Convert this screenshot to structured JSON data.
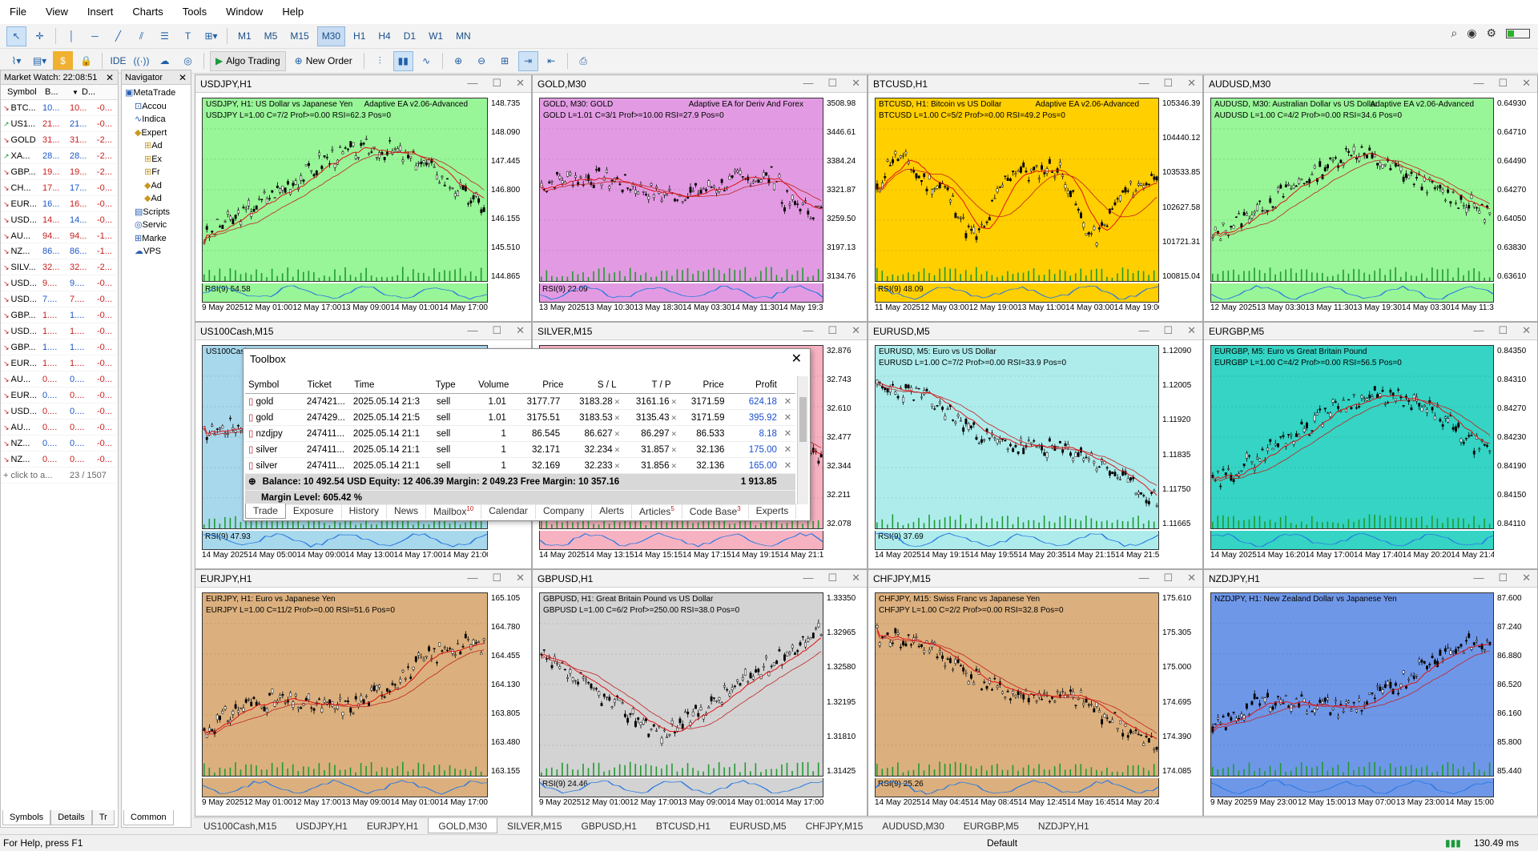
{
  "menu": [
    "File",
    "View",
    "Insert",
    "Charts",
    "Tools",
    "Window",
    "Help"
  ],
  "timeframes": [
    "M1",
    "M5",
    "M15",
    "M30",
    "H1",
    "H4",
    "D1",
    "W1",
    "MN"
  ],
  "active_tf": "M30",
  "toolbar2": {
    "ide": "IDE",
    "algo": "Algo Trading",
    "new_order": "New Order"
  },
  "market_watch": {
    "title": "Market Watch: 22:08:51",
    "cols": [
      "Symbol",
      "B...",
      "D..."
    ],
    "rows": [
      [
        "BTC...",
        "10...",
        "10..."
      ],
      [
        "US1...",
        "21...",
        "21..."
      ],
      [
        "GOLD",
        "31...",
        "31..."
      ],
      [
        "XA...",
        "28...",
        "28..."
      ],
      [
        "GBP...",
        "19...",
        "19..."
      ],
      [
        "CH...",
        "17...",
        "17..."
      ],
      [
        "EUR...",
        "16...",
        "16..."
      ],
      [
        "USD...",
        "14...",
        "14..."
      ],
      [
        "AU...",
        "94...",
        "94..."
      ],
      [
        "NZ...",
        "86...",
        "86..."
      ],
      [
        "SILV...",
        "32...",
        "32..."
      ],
      [
        "USD...",
        "9....",
        "9...."
      ],
      [
        "USD...",
        "7....",
        "7...."
      ],
      [
        "GBP...",
        "1....",
        "1...."
      ],
      [
        "USD...",
        "1....",
        "1...."
      ],
      [
        "GBP...",
        "1....",
        "1...."
      ],
      [
        "EUR...",
        "1....",
        "1...."
      ],
      [
        "AU...",
        "0....",
        "0...."
      ],
      [
        "EUR...",
        "0....",
        "0...."
      ],
      [
        "USD...",
        "0....",
        "0...."
      ],
      [
        "AU...",
        "0....",
        "0...."
      ],
      [
        "NZ...",
        "0....",
        "0...."
      ],
      [
        "NZ...",
        "0....",
        "0...."
      ]
    ],
    "third": [
      "-0...",
      "-0...",
      "-2...",
      "-2...",
      "-2...",
      "-0...",
      "-0...",
      "-0...",
      "-1...",
      "-1...",
      "-2...",
      "-0...",
      "-0...",
      "-0...",
      "-0...",
      "-0...",
      "-0...",
      "-0...",
      "-0...",
      "-0...",
      "-0...",
      "-0...",
      "-0..."
    ],
    "add": "+ click to a...",
    "count": "23 / 1507",
    "tabs": [
      "Symbols",
      "Details",
      "Tr"
    ]
  },
  "navigator": {
    "title": "Navigator",
    "items": [
      "MetaTrade",
      "Accou",
      "Indica",
      "Expert",
      "Ad",
      "Ex",
      "Fr",
      "Ad",
      "Ad",
      "Scripts",
      "Servic",
      "Marke",
      "VPS"
    ],
    "tab": "Common"
  },
  "charts": [
    {
      "title": "USDJPY,H1",
      "sym": "USDJPY, H1:  US Dollar vs Japanese Yen",
      "ea": "Adaptive EA v2.06-Advanced",
      "info": "USDJPY L=1.00 C=7/2 Prof>=0.00 RSI=62.3 Pos=0",
      "y": [
        "148.735",
        "148.090",
        "147.445",
        "146.800",
        "146.155",
        "145.510",
        "144.865"
      ],
      "x": [
        "9 May 2025",
        "12 May 01:00",
        "12 May 17:00",
        "13 May 09:00",
        "14 May 01:00",
        "14 May 17:00"
      ],
      "rsi": "RSI(9) 54.58",
      "color": "#98f598",
      "seed": 3,
      "trend": "upflat"
    },
    {
      "title": "GOLD,M30",
      "sym": "GOLD, M30:  GOLD",
      "ea": "Adaptive EA for Deriv And Forex",
      "info": "GOLD L=1.01 C=3/1 Prof>=10.00 RSI=27.9 Pos=0",
      "y": [
        "3508.98",
        "3446.61",
        "3384.24",
        "3321.87",
        "3259.50",
        "3197.13",
        "3134.76"
      ],
      "x": [
        "13 May 2025",
        "13 May 10:30",
        "13 May 18:30",
        "14 May 03:30",
        "14 May 11:30",
        "14 May 19:30"
      ],
      "rsi": "RSI(9) 22.09",
      "color": "#e29be2",
      "seed": 7,
      "trend": "flat"
    },
    {
      "title": "BTCUSD,H1",
      "sym": "BTCUSD, H1:  Bitcoin vs US Dollar",
      "ea": "Adaptive EA v2.06-Advanced",
      "info": "BTCUSD L=1.00 C=5/2 Prof>=0.00 RSI=49.2 Pos=0",
      "y": [
        "105346.39",
        "104440.12",
        "103533.85",
        "102627.58",
        "101721.31",
        "100815.04"
      ],
      "x": [
        "11 May 2025",
        "12 May 03:00",
        "12 May 19:00",
        "13 May 11:00",
        "14 May 03:00",
        "14 May 19:00"
      ],
      "rsi": "RSI(9) 48.09",
      "color": "#ffcf00",
      "seed": 11,
      "trend": "wave"
    },
    {
      "title": "AUDUSD,M30",
      "sym": "AUDUSD, M30:  Australian Dollar vs US Dollar",
      "ea": "Adaptive EA v2.06-Advanced",
      "info": "AUDUSD L=1.00 C=4/2 Prof>=0.00 RSI=34.6 Pos=0",
      "y": [
        "0.64930",
        "0.64710",
        "0.64490",
        "0.64270",
        "0.64050",
        "0.63830",
        "0.63610"
      ],
      "x": [
        "12 May 2025",
        "13 May 03:30",
        "13 May 11:30",
        "13 May 19:30",
        "14 May 03:30",
        "14 May 11:30"
      ],
      "rsi": "",
      "color": "#98f598",
      "seed": 13,
      "trend": "upthen"
    },
    {
      "title": "US100Cash,M15",
      "sym": "US100Cash",
      "ea": "",
      "info": "",
      "y": [],
      "x": [
        "14 May 2025",
        "14 May 05:00",
        "14 May 09:00",
        "14 May 13:00",
        "14 May 17:00",
        "14 May 21:00"
      ],
      "rsi": "RSI(9) 47.93",
      "color": "#a8d8ec",
      "seed": 17,
      "trend": "flat"
    },
    {
      "title": "SILVER,M15",
      "sym": "",
      "ea": "",
      "info": "",
      "y": [
        "32.876",
        "32.743",
        "32.610",
        "32.477",
        "32.344",
        "32.211",
        "32.078"
      ],
      "x": [
        "14 May 2025",
        "14 May 13:15",
        "14 May 15:15",
        "14 May 17:15",
        "14 May 19:15",
        "14 May 21:15"
      ],
      "rsi": "",
      "color": "#f7b2c2",
      "seed": 19,
      "trend": "flat"
    },
    {
      "title": "EURUSD,M5",
      "sym": "EURUSD, M5:  Euro vs US Dollar",
      "ea": "",
      "info": "EURUSD L=1.00 C=7/2 Prof>=0.00 RSI=33.9 Pos=0",
      "y": [
        "1.12090",
        "1.12005",
        "1.11920",
        "1.11835",
        "1.11750",
        "1.11665"
      ],
      "x": [
        "14 May 2025",
        "14 May 19:15",
        "14 May 19:55",
        "14 May 20:35",
        "14 May 21:15",
        "14 May 21:55"
      ],
      "rsi": "RSI(9) 37.69",
      "color": "#aeecec",
      "seed": 23,
      "trend": "down"
    },
    {
      "title": "EURGBP,M5",
      "sym": "EURGBP, M5:  Euro vs Great Britain Pound",
      "ea": "",
      "info": "EURGBP L=1.00 C=4/2 Prof>=0.00 RSI=56.5 Pos=0",
      "y": [
        "0.84350",
        "0.84310",
        "0.84270",
        "0.84230",
        "0.84190",
        "0.84150",
        "0.84110"
      ],
      "x": [
        "14 May 2025",
        "14 May 16:20",
        "14 May 17:00",
        "14 May 17:40",
        "14 May 20:20",
        "14 May 21:40"
      ],
      "rsi": "",
      "color": "#35d4c4",
      "seed": 29,
      "trend": "upflat"
    },
    {
      "title": "EURJPY,H1",
      "sym": "EURJPY, H1:  Euro vs Japanese Yen",
      "ea": "",
      "info": "EURJPY L=1.00 C=11/2 Prof>=0.00 RSI=51.6 Pos=0",
      "y": [
        "165.105",
        "164.780",
        "164.455",
        "164.130",
        "163.805",
        "163.480",
        "163.155"
      ],
      "x": [
        "9 May 2025",
        "12 May 01:00",
        "12 May 17:00",
        "13 May 09:00",
        "14 May 01:00",
        "14 May 17:00"
      ],
      "rsi": "",
      "color": "#dbb07e",
      "seed": 31,
      "trend": "up"
    },
    {
      "title": "GBPUSD,H1",
      "sym": "GBPUSD, H1:  Great Britain Pound vs US Dollar",
      "ea": "",
      "info": "GBPUSD L=1.00 C=6/2 Prof>=250.00 RSI=38.0 Pos=0",
      "y": [
        "1.33350",
        "1.32965",
        "1.32580",
        "1.32195",
        "1.31810",
        "1.31425"
      ],
      "x": [
        "9 May 2025",
        "12 May 01:00",
        "12 May 17:00",
        "13 May 09:00",
        "14 May 01:00",
        "14 May 17:00"
      ],
      "rsi": "RSI(9) 24.46",
      "color": "#d3d3d3",
      "seed": 37,
      "trend": "vshape"
    },
    {
      "title": "CHFJPY,M15",
      "sym": "CHFJPY, M15:  Swiss Franc vs Japanese Yen",
      "ea": "",
      "info": "CHFJPY L=1.00 C=2/2 Prof>=0.00 RSI=32.8 Pos=0",
      "y": [
        "175.610",
        "175.305",
        "175.000",
        "174.695",
        "174.390",
        "174.085"
      ],
      "x": [
        "14 May 2025",
        "14 May 04:45",
        "14 May 08:45",
        "14 May 12:45",
        "14 May 16:45",
        "14 May 20:45"
      ],
      "rsi": "RSI(9) 25.26",
      "color": "#dbb07e",
      "seed": 41,
      "trend": "down"
    },
    {
      "title": "NZDJPY,H1",
      "sym": "NZDJPY, H1:  New Zealand Dollar vs Japanese Yen",
      "ea": "",
      "info": "",
      "y": [
        "87.600",
        "87.240",
        "86.880",
        "86.520",
        "86.160",
        "85.800",
        "85.440"
      ],
      "x": [
        "9 May 2025",
        "9 May 23:00",
        "12 May 15:00",
        "13 May 07:00",
        "13 May 23:00",
        "14 May 15:00"
      ],
      "rsi": "",
      "color": "#6f97e8",
      "seed": 43,
      "trend": "up"
    }
  ],
  "toolbox": {
    "title": "Toolbox",
    "head": [
      "Symbol",
      "Ticket",
      "Time",
      "Type",
      "Volume",
      "Price",
      "S / L",
      "T / P",
      "Price",
      "Profit"
    ],
    "rows": [
      [
        "gold",
        "247421...",
        "2025.05.14 21:3...",
        "sell",
        "1.01",
        "3177.77",
        "3183.28",
        "3161.16",
        "3171.59",
        "624.18"
      ],
      [
        "gold",
        "247429...",
        "2025.05.14 21:5...",
        "sell",
        "1.01",
        "3175.51",
        "3183.53",
        "3135.43",
        "3171.59",
        "395.92"
      ],
      [
        "nzdjpy",
        "247411...",
        "2025.05.14 21:1...",
        "sell",
        "1",
        "86.545",
        "86.627",
        "86.297",
        "86.533",
        "8.18"
      ],
      [
        "silver",
        "247411...",
        "2025.05.14 21:1...",
        "sell",
        "1",
        "32.171",
        "32.234",
        "31.857",
        "32.136",
        "175.00"
      ],
      [
        "silver",
        "247411...",
        "2025.05.14 21:1...",
        "sell",
        "1",
        "32.169",
        "32.233",
        "31.856",
        "32.136",
        "165.00"
      ]
    ],
    "summary": "Balance: 10 492.54 USD  Equity: 12 406.39  Margin: 2 049.23  Free Margin: 10 357.16",
    "summary_profit": "1 913.85",
    "margin_level": "Margin Level: 605.42 %",
    "tabs": [
      "Trade",
      "Exposure",
      "History",
      "News",
      "Mailbox",
      "Calendar",
      "Company",
      "Alerts",
      "Articles",
      "Code Base",
      "Experts"
    ],
    "badges": {
      "Mailbox": "10",
      "Articles": "5",
      "Code Base": "3"
    }
  },
  "chart_tabs": [
    "US100Cash,M15",
    "USDJPY,H1",
    "EURJPY,H1",
    "GOLD,M30",
    "SILVER,M15",
    "GBPUSD,H1",
    "BTCUSD,H1",
    "EURUSD,M5",
    "CHFJPY,M15",
    "AUDUSD,M30",
    "EURGBP,M5",
    "NZDJPY,H1"
  ],
  "active_chart_tab": "GOLD,M30",
  "status": {
    "help": "For Help, press F1",
    "profile": "Default",
    "ping": "130.49 ms"
  }
}
